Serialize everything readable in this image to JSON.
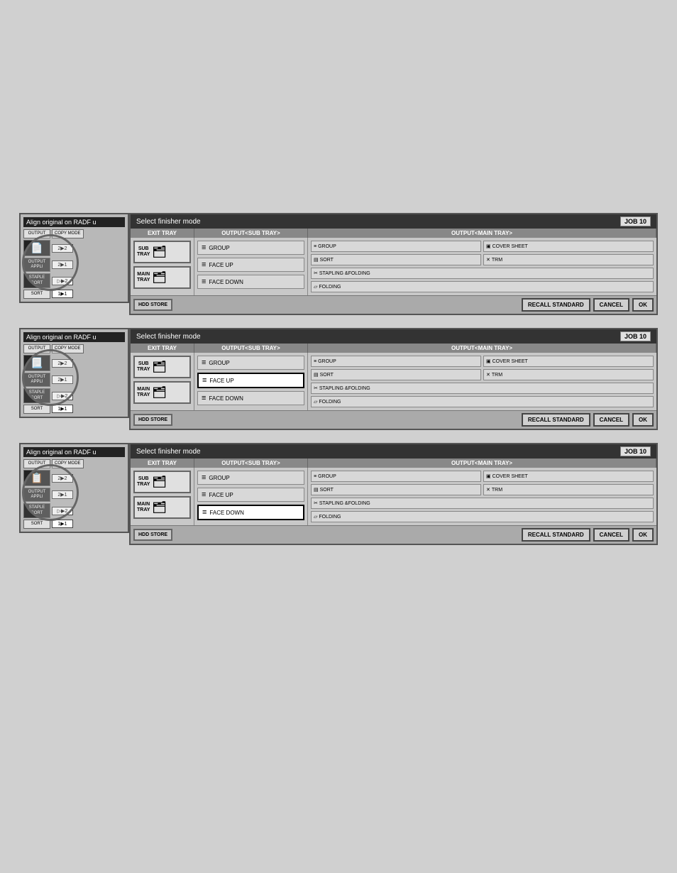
{
  "panels": [
    {
      "id": "panel1",
      "left": {
        "header": "Align original on RADF u",
        "rows": [
          {
            "label": "OUTPUT",
            "mode": "COPY MODE"
          },
          {
            "btn1": "OUTPUT",
            "icon": "📄",
            "seq1": "2▶2"
          },
          {
            "btn1": "OUTPUT APPLI",
            "seq1": "2▶1"
          },
          {
            "btn1": "STAPLE SORT",
            "seq1": "▷▶2"
          },
          {
            "btn1": "SORT",
            "seq1": "1▶1"
          }
        ]
      },
      "right": {
        "title": "Select finisher mode",
        "job": "JOB 10",
        "exitTray": {
          "subTray": {
            "label": "SUB TRAY",
            "selected": false
          },
          "mainTray": {
            "label": "MAIN TRAY",
            "selected": false
          }
        },
        "subTrayModes": [
          {
            "label": "GROUP",
            "icon": "≡",
            "selected": false
          },
          {
            "label": "FACE UP",
            "icon": "≡",
            "selected": false
          },
          {
            "label": "FACE DOWN",
            "icon": "≡",
            "selected": false
          }
        ],
        "mainTrayModes": [
          {
            "row": [
              {
                "label": "GROUP",
                "icon": "≡"
              },
              {
                "label": "COVER SHEET",
                "icon": "▣"
              }
            ]
          },
          {
            "row": [
              {
                "label": "SORT",
                "icon": "▤"
              },
              {
                "label": "TRM",
                "icon": "✕"
              }
            ]
          },
          {
            "row": [
              {
                "label": "STAPLING &FOLDING",
                "icon": "✂"
              }
            ]
          },
          {
            "row": [
              {
                "label": "FOLDING",
                "icon": "▱"
              }
            ]
          }
        ],
        "bottom": {
          "hddStore": "HDD STORE",
          "recallStandard": "RECALL STANDARD",
          "cancel": "CANCEL",
          "ok": "OK"
        }
      },
      "activeLeft": "output",
      "activeSub": "none",
      "activeMain": "none"
    },
    {
      "id": "panel2",
      "left": {
        "header": "Align original on RADF u"
      },
      "right": {
        "title": "Select finisher mode",
        "job": "JOB 10",
        "bottom": {
          "hddStore": "HDD STORE",
          "recallStandard": "RECALL STANDARD",
          "cancel": "CANCEL",
          "ok": "OK"
        }
      },
      "activeSub": "faceUp",
      "activeMain": "none"
    },
    {
      "id": "panel3",
      "left": {
        "header": "Align original on RADF u"
      },
      "right": {
        "title": "Select finisher mode",
        "job": "JOB 10",
        "bottom": {
          "hddStore": "HDD STORE",
          "recallStandard": "RECALL STANDARD",
          "cancel": "CANCEL",
          "ok": "OK"
        }
      },
      "activeSub": "faceDown",
      "activeMain": "none"
    }
  ],
  "labels": {
    "exitTray": "EXIT TRAY",
    "outputSubTray": "OUTPUT<SUB TRAY>",
    "outputMainTray": "OUTPUT<MAIN TRAY>",
    "subTray": "SUB TRAY",
    "mainTray": "MAIN TRAY",
    "group": "GROUP",
    "faceUp": "FACE UP",
    "faceDown": "FACE DOWN",
    "sort": "SORT",
    "coverSheet": "COVER SHEET",
    "trm": "TRM",
    "staplingFolding": "STAPLING &FOLDING",
    "folding": "FOLDING",
    "hddStore": "HDD STORE",
    "recallStandard": "RECALL STANDARD",
    "cancel": "CANCEL",
    "ok": "OK",
    "output": "OUTPUT",
    "copyMode": "COPY MODE",
    "radf": "RADF",
    "outputAppli": "OUTPUT APPLI",
    "stapleSort": "STAPLE SORT",
    "sort2": "SORT",
    "jobBadge": "JOB 10",
    "panelTitle": "Select finisher mode",
    "alignHeader": "Align original on RADF u"
  }
}
